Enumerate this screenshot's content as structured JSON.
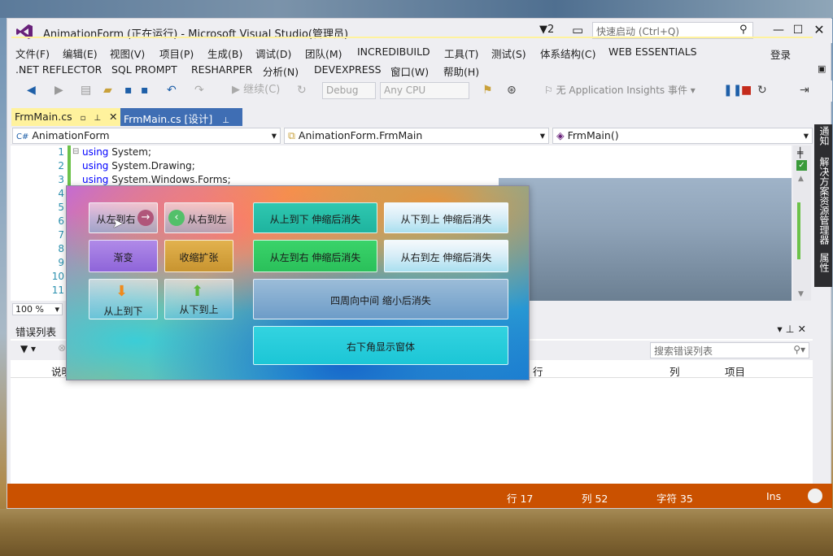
{
  "window": {
    "title": "AnimationForm (正在运行) - Microsoft Visual Studio(管理员)",
    "flag_count": "2",
    "quick_launch_placeholder": "快速启动 (Ctrl+Q)",
    "login": "登录"
  },
  "menu_row1": [
    "文件(F)",
    "编辑(E)",
    "视图(V)",
    "项目(P)",
    "生成(B)",
    "调试(D)",
    "团队(M)",
    "INCREDIBUILD",
    "工具(T)",
    "测试(S)",
    "体系结构(C)",
    "WEB ESSENTIALS"
  ],
  "menu_row2": [
    ".NET REFLECTOR",
    "SQL PROMPT",
    "RESHARPER",
    "分析(N)",
    "DEVEXPRESS",
    "窗口(W)",
    "帮助(H)"
  ],
  "toolbar": {
    "continue_label": "继续(C)",
    "config": "Debug",
    "platform": "Any CPU",
    "insights": "无 Application Insights 事件"
  },
  "tabs": {
    "active": "FrmMain.cs",
    "design": "FrmMain.cs [设计]"
  },
  "navbar": {
    "project": "AnimationForm",
    "type": "AnimationForm.FrmMain",
    "member": "FrmMain()"
  },
  "editor": {
    "line_numbers": [
      "1",
      "2",
      "3",
      "4",
      "5",
      "6",
      "7",
      "8",
      "9",
      "10",
      "11"
    ],
    "lines": [
      {
        "kw": "using",
        "rest": " System;"
      },
      {
        "kw": "using",
        "rest": " System.Drawing;"
      },
      {
        "kw": "using",
        "rest": " System.Windows.Forms;"
      }
    ],
    "zoom": "100 %"
  },
  "side_tabs": [
    "通知",
    "解决方案资源管理器",
    "属性"
  ],
  "error_list": {
    "title": "错误列表",
    "search_placeholder": "搜索错误列表",
    "columns": [
      "说明",
      "行",
      "列",
      "项目"
    ]
  },
  "status": {
    "line": "行 17",
    "col": "列 52",
    "char": "字符 35",
    "mode": "Ins"
  },
  "anim_form": {
    "btn_l2r": "从左到右",
    "btn_r2l": "从右到左",
    "btn_fade": "渐变",
    "btn_shrink": "收缩扩张",
    "btn_t2b": "从上到下",
    "btn_b2t": "从下到上",
    "btn_t2b_stretch": "从上到下  伸缩后消失",
    "btn_b2t_stretch": "从下到上  伸缩后消失",
    "btn_l2r_stretch": "从左到右  伸缩后消失",
    "btn_r2l_stretch": "从右到左  伸缩后消失",
    "btn_center": "四周向中间 缩小后消失",
    "btn_bottomright": "右下角显示窗体"
  }
}
